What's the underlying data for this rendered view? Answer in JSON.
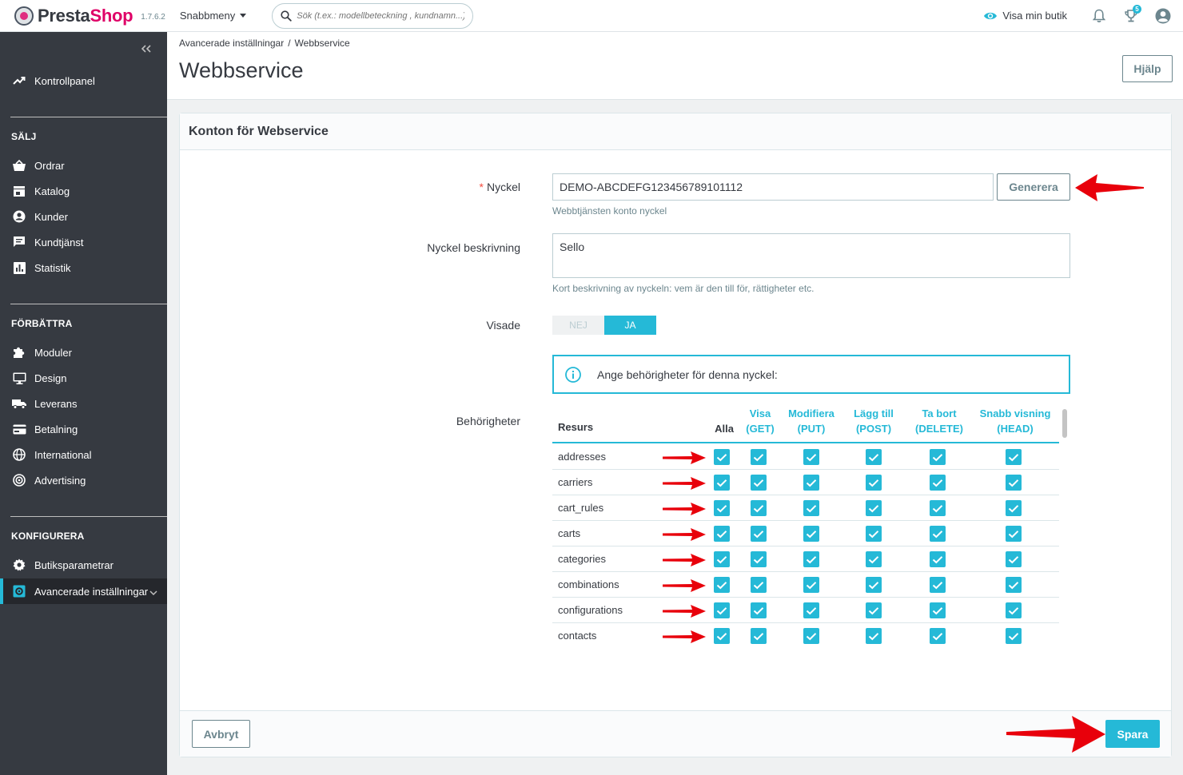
{
  "topbar": {
    "brand_part1": "Presta",
    "brand_part2": "Shop",
    "version": "1.7.6.2",
    "quick_access": "Snabbmeny",
    "search_placeholder": "Sök (t.ex.: modellbeteckning , kundnamn...)",
    "view_shop": "Visa min butik",
    "orders_badge": "5"
  },
  "sidebar": {
    "dashboard": "Kontrollpanel",
    "sell_heading": "SÄLJ",
    "sell_items": [
      "Ordrar",
      "Katalog",
      "Kunder",
      "Kundtjänst",
      "Statistik"
    ],
    "improve_heading": "FÖRBÄTTRA",
    "improve_items": [
      "Moduler",
      "Design",
      "Leverans",
      "Betalning",
      "International",
      "Advertising"
    ],
    "configure_heading": "KONFIGURERA",
    "configure_items": [
      "Butiksparametrar",
      "Avancerade inställningar"
    ]
  },
  "header": {
    "breadcrumb_parent": "Avancerade inställningar",
    "breadcrumb_sep": "/",
    "breadcrumb_current": "Webbservice",
    "title": "Webbservice",
    "help_label": "Hjälp"
  },
  "form": {
    "panel_title": "Konton för Webservice",
    "key_required_mark": "*",
    "key_label": "Nyckel",
    "key_value": "DEMO-ABCDEFG123456789101112",
    "generate_label": "Generera",
    "key_help": "Webbtjänsten konto nyckel",
    "desc_label": "Nyckel beskrivning",
    "desc_value": "Sello",
    "desc_help": "Kort beskrivning av nyckeln: vem är den till för, rättigheter etc.",
    "status_label": "Visade",
    "toggle_no": "NEJ",
    "toggle_yes": "JA",
    "status_value": "JA",
    "info_text": "Ange behörigheter för denna nyckel:",
    "permissions_label": "Behörigheter",
    "cancel_label": "Avbryt",
    "save_label": "Spara"
  },
  "permissions": {
    "col_resource": "Resurs",
    "col_all": "Alla",
    "columns": [
      {
        "line1": "Visa",
        "line2": "(GET)"
      },
      {
        "line1": "Modifiera",
        "line2": "(PUT)"
      },
      {
        "line1": "Lägg till",
        "line2": "(POST)"
      },
      {
        "line1": "Ta bort",
        "line2": "(DELETE)"
      },
      {
        "line1": "Snabb visning",
        "line2": "(HEAD)"
      }
    ],
    "rows": [
      {
        "name": "addresses",
        "all": true,
        "get": true,
        "put": true,
        "post": true,
        "delete": true,
        "head": true
      },
      {
        "name": "carriers",
        "all": true,
        "get": true,
        "put": true,
        "post": true,
        "delete": true,
        "head": true
      },
      {
        "name": "cart_rules",
        "all": true,
        "get": true,
        "put": true,
        "post": true,
        "delete": true,
        "head": true
      },
      {
        "name": "carts",
        "all": true,
        "get": true,
        "put": true,
        "post": true,
        "delete": true,
        "head": true
      },
      {
        "name": "categories",
        "all": true,
        "get": true,
        "put": true,
        "post": true,
        "delete": true,
        "head": true
      },
      {
        "name": "combinations",
        "all": true,
        "get": true,
        "put": true,
        "post": true,
        "delete": true,
        "head": true
      },
      {
        "name": "configurations",
        "all": true,
        "get": true,
        "put": true,
        "post": true,
        "delete": true,
        "head": true
      },
      {
        "name": "contacts",
        "all": true,
        "get": true,
        "put": true,
        "post": true,
        "delete": true,
        "head": true
      }
    ]
  },
  "colors": {
    "accent": "#25b9d7",
    "sidebar_bg": "#363a41",
    "annotation_arrow": "#e8000b",
    "brand_pink": "#df0067"
  }
}
